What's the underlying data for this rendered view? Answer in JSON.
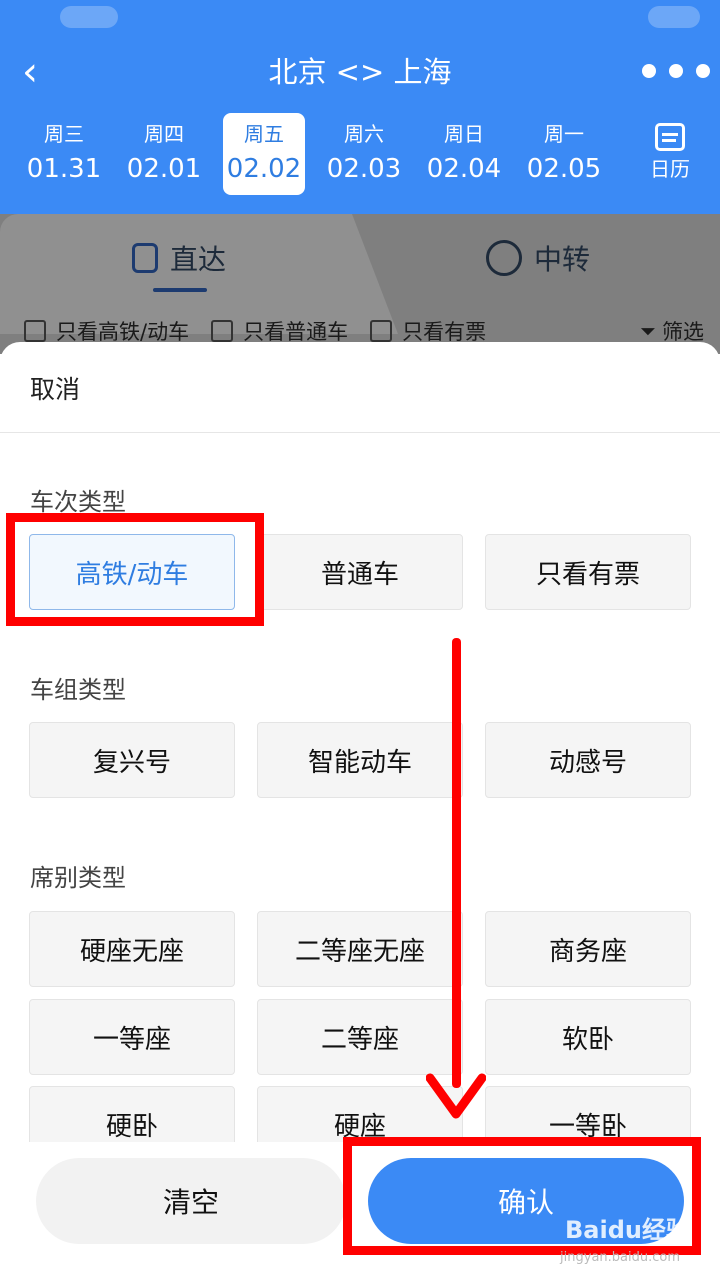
{
  "header": {
    "back_icon": "chevron-left-icon",
    "route": "北京 <> 上海",
    "more_icon": "more-dots-icon",
    "dates": [
      {
        "weekday": "周三",
        "date": "01.31"
      },
      {
        "weekday": "周四",
        "date": "02.01"
      },
      {
        "weekday": "周五",
        "date": "02.02"
      },
      {
        "weekday": "周六",
        "date": "02.03"
      },
      {
        "weekday": "周日",
        "date": "02.04"
      },
      {
        "weekday": "周一",
        "date": "02.05"
      }
    ],
    "selected_date_index": 2,
    "calendar_label": "日历"
  },
  "tabs": {
    "direct": "直达",
    "transfer": "中转"
  },
  "quick_filters": {
    "high_speed": "只看高铁/动车",
    "normal": "只看普通车",
    "available": "只看有票",
    "screen": "筛选"
  },
  "sheet": {
    "cancel": "取消",
    "train_type": {
      "title": "车次类型",
      "options": [
        "高铁/动车",
        "普通车",
        "只看有票"
      ],
      "selected_index": 0
    },
    "group_type": {
      "title": "车组类型",
      "options": [
        "复兴号",
        "智能动车",
        "动感号"
      ]
    },
    "seat_type": {
      "title": "席别类型",
      "options": [
        "硬座无座",
        "二等座无座",
        "商务座",
        "一等座",
        "二等座",
        "软卧",
        "硬卧",
        "硬座",
        "一等卧"
      ]
    },
    "clear": "清空",
    "confirm": "确认"
  },
  "watermark": {
    "brand": "Baidu经验",
    "url": "jingyan.baidu.com"
  },
  "colors": {
    "brand_blue": "#3b8af5",
    "selected_text": "#2f7de1",
    "annotation_red": "#ff0000"
  }
}
